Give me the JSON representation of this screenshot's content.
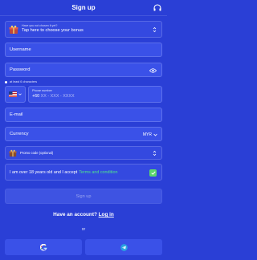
{
  "header": {
    "title": "Sign up",
    "support_icon": "headset-icon"
  },
  "bonus": {
    "small_text": "Have you not chosen it yet?",
    "main_text": "Tap here to choose your bonus",
    "icon": "gift-icon"
  },
  "username": {
    "placeholder": "Username"
  },
  "password": {
    "placeholder": "Password",
    "icon": "eye-icon"
  },
  "password_hint": "at least 6 characters",
  "phone": {
    "country_icon": "us-flag-icon",
    "label": "Phone number",
    "prefix": "+60",
    "placeholder": "XX - XXX - XXXX"
  },
  "email": {
    "placeholder": "E-mail"
  },
  "currency": {
    "label": "Currency",
    "value": "MYR"
  },
  "promo": {
    "label": "Promo code (optional)",
    "icon": "gift-icon"
  },
  "terms": {
    "text": "I am over 18 years old and I accept",
    "link": "Terms and condition",
    "checked": true
  },
  "signup_button": "Sign up",
  "account": {
    "question": "Have an account?",
    "login": "Log in"
  },
  "or": "or",
  "social": [
    {
      "name": "Google"
    },
    {
      "name": "Telegram"
    }
  ],
  "colors": {
    "background": "#2a3fd6",
    "field": "#3a51e8",
    "accent_green": "#4ee38f",
    "checkbox": "#5bd86b"
  }
}
